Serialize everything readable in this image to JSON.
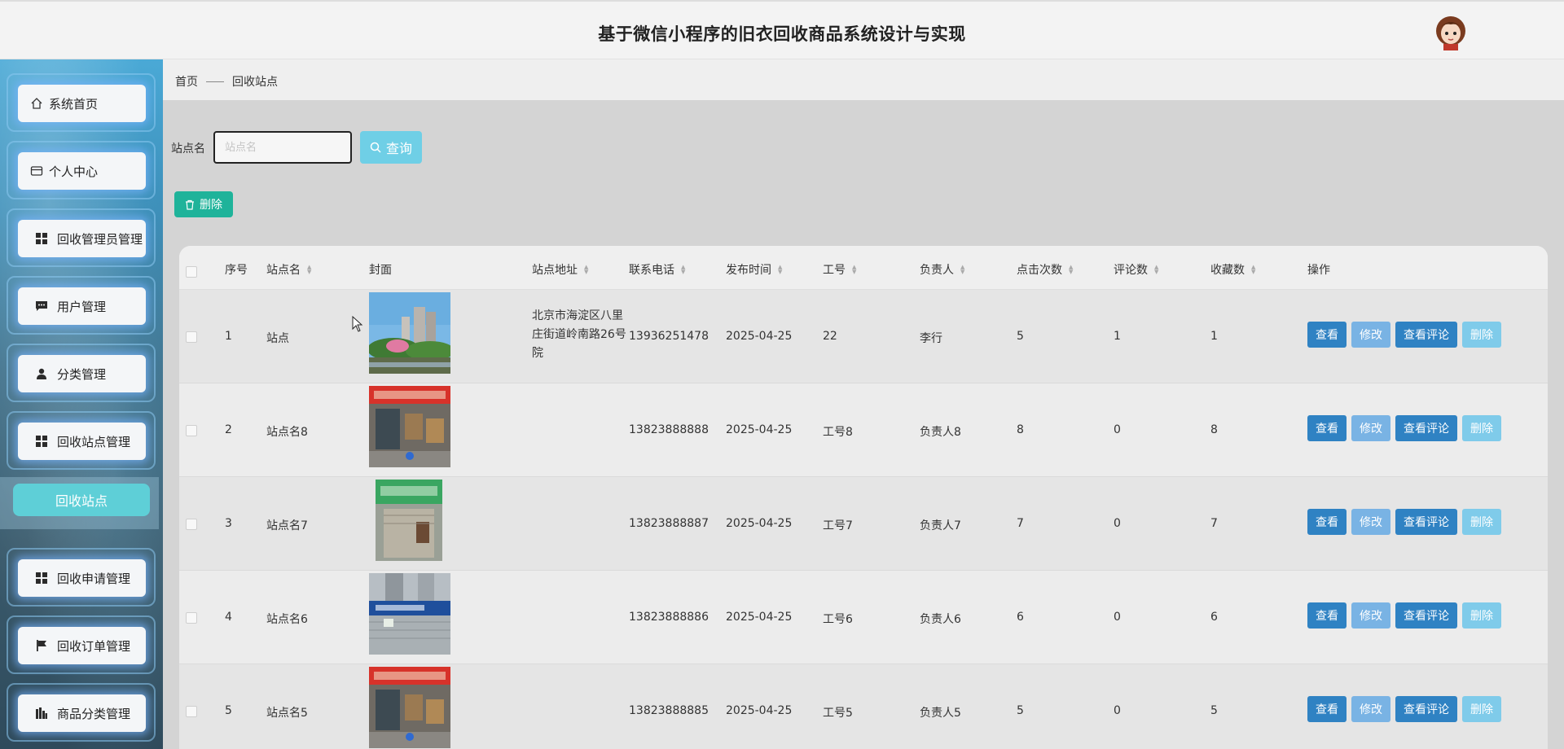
{
  "header": {
    "title": "基于微信小程序的旧衣回收商品系统设计与实现"
  },
  "sidebar": {
    "items": [
      {
        "label": "系统首页",
        "icon": "home-icon"
      },
      {
        "label": "个人中心",
        "icon": "card-icon"
      },
      {
        "label": "回收管理员管理",
        "icon": "grid-icon"
      },
      {
        "label": "用户管理",
        "icon": "chat-icon"
      },
      {
        "label": "分类管理",
        "icon": "user-icon"
      },
      {
        "label": "回收站点管理",
        "icon": "grid-icon"
      },
      {
        "label": "回收申请管理",
        "icon": "grid-icon"
      },
      {
        "label": "回收订单管理",
        "icon": "flag-icon"
      },
      {
        "label": "商品分类管理",
        "icon": "chart-icon"
      }
    ],
    "active_sub": "回收站点"
  },
  "breadcrumb": {
    "home": "首页",
    "current": "回收站点"
  },
  "search": {
    "label": "站点名",
    "placeholder": "站点名",
    "button": "查询"
  },
  "toolbar": {
    "delete_label": "删除"
  },
  "table": {
    "headers": [
      "序号",
      "站点名",
      "封面",
      "站点地址",
      "联系电话",
      "发布时间",
      "工号",
      "负责人",
      "点击次数",
      "评论数",
      "收藏数",
      "操作"
    ],
    "rows": [
      {
        "index": "1",
        "name": "站点",
        "address": "北京市海淀区八里庄街道岭南路26号院",
        "phone": "13936251478",
        "date": "2025-04-25",
        "job_no": "22",
        "manager": "李行",
        "clicks": "5",
        "comments": "1",
        "favorites": "1"
      },
      {
        "index": "2",
        "name": "站点名8",
        "address": "",
        "phone": "13823888888",
        "date": "2025-04-25",
        "job_no": "工号8",
        "manager": "负责人8",
        "clicks": "8",
        "comments": "0",
        "favorites": "8"
      },
      {
        "index": "3",
        "name": "站点名7",
        "address": "",
        "phone": "13823888887",
        "date": "2025-04-25",
        "job_no": "工号7",
        "manager": "负责人7",
        "clicks": "7",
        "comments": "0",
        "favorites": "7"
      },
      {
        "index": "4",
        "name": "站点名6",
        "address": "",
        "phone": "13823888886",
        "date": "2025-04-25",
        "job_no": "工号6",
        "manager": "负责人6",
        "clicks": "6",
        "comments": "0",
        "favorites": "6"
      },
      {
        "index": "5",
        "name": "站点名5",
        "address": "",
        "phone": "13823888885",
        "date": "2025-04-25",
        "job_no": "工号5",
        "manager": "负责人5",
        "clicks": "5",
        "comments": "0",
        "favorites": "5"
      }
    ],
    "actions": {
      "view": "查看",
      "edit": "修改",
      "comments": "查看评论",
      "delete": "删除"
    }
  },
  "colors": {
    "primary": "#2f82c3",
    "accent_green": "#1fb39a",
    "active_menu": "#5ecfd7"
  }
}
